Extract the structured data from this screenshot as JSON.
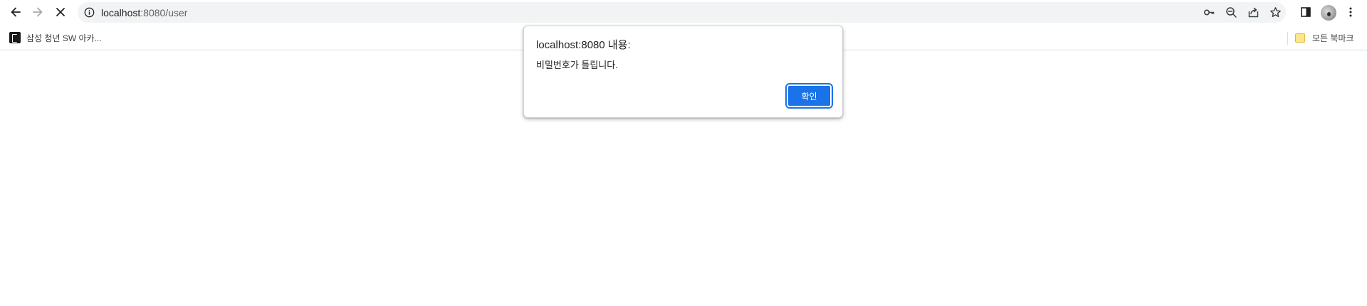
{
  "toolbar": {
    "url_host": "localhost",
    "url_path": ":8080/user",
    "back_icon": "arrow-left-icon",
    "forward_icon": "arrow-right-icon",
    "stop_icon": "close-icon"
  },
  "bookmarks": {
    "items": [
      {
        "label": "삼성 청년 SW 아카...",
        "icon": "site-favicon"
      }
    ],
    "all_bookmarks_label": "모든 북마크"
  },
  "dialog": {
    "title": "localhost:8080 내용:",
    "message": "비밀번호가 틀립니다.",
    "ok_label": "확인"
  },
  "colors": {
    "accent": "#1a73e8",
    "omnibox_bg": "#f1f3f4"
  }
}
